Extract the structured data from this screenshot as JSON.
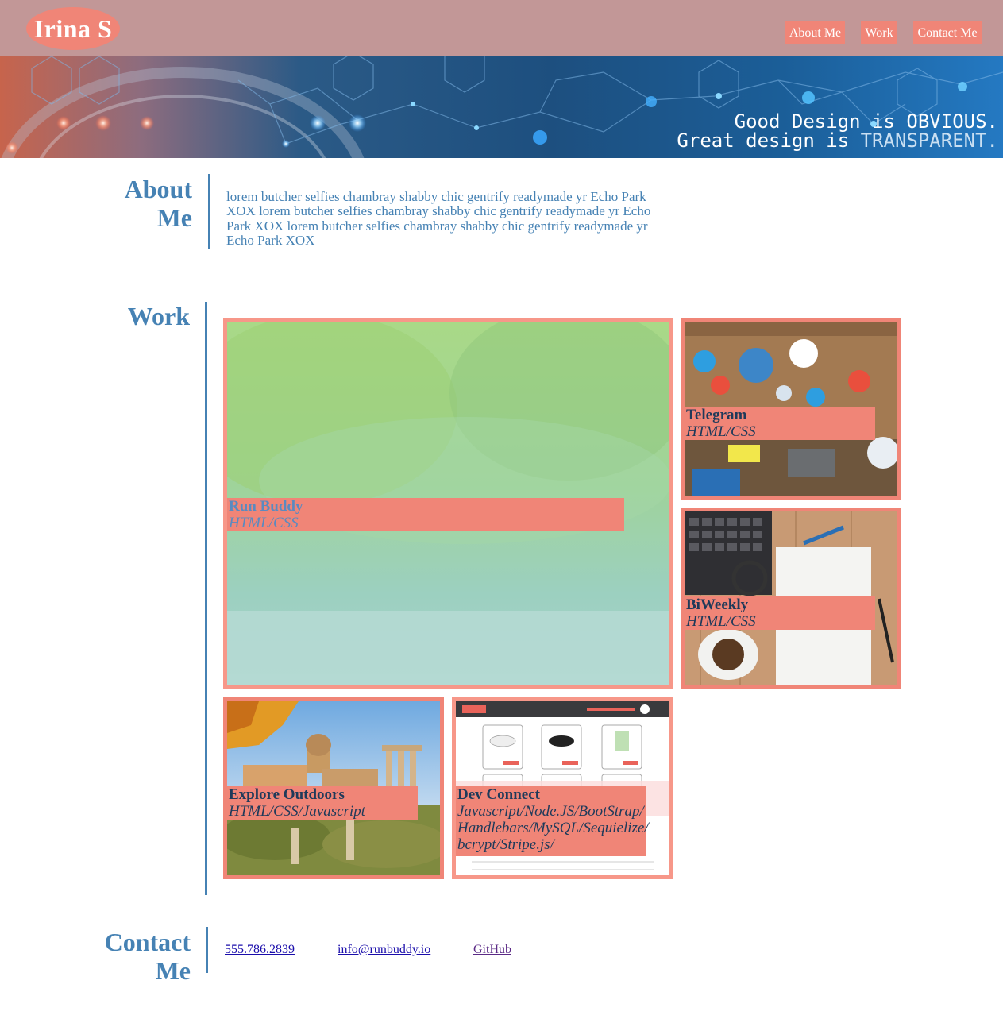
{
  "header": {
    "brand": "Irina S",
    "nav": [
      "About Me",
      "Work",
      "Contact Me"
    ]
  },
  "hero": {
    "line1_a": "Good Design is ",
    "line1_b": "OBVIOUS.",
    "line2_a": "Great design is ",
    "line2_b": "TRANSPARENT."
  },
  "about": {
    "title": "About Me",
    "paragraph": "lorem butcher selfies chambray shabby chic gentrify readymade yr Echo Park XOX lorem butcher selfies chambray shabby chic gentrify readymade yr Echo Park XOX lorem butcher selfies chambray shabby chic gentrify readymade yr Echo Park XOX"
  },
  "work": {
    "title": "Work",
    "projects": [
      {
        "name": "Run Buddy",
        "tech": "HTML/CSS"
      },
      {
        "name": "Telegram",
        "tech": "HTML/CSS"
      },
      {
        "name": "BiWeekly",
        "tech": "HTML/CSS"
      },
      {
        "name": "Explore Outdoors",
        "tech": "HTML/CSS/Javascript"
      },
      {
        "name": "Dev Connect",
        "tech": "Javascript/Node.JS/BootStrap/ Handlebars/MySQL/Sequielize/ bcrypt/Stripe.js/"
      }
    ]
  },
  "contact": {
    "title": "Contact Me",
    "phone": "555.786.2839 ",
    "email": "info@runbuddy.io",
    "github": "GitHub"
  },
  "colors": {
    "header_bg": "#c29797",
    "accent": "#f08577",
    "heading_blue": "#4682b4"
  }
}
